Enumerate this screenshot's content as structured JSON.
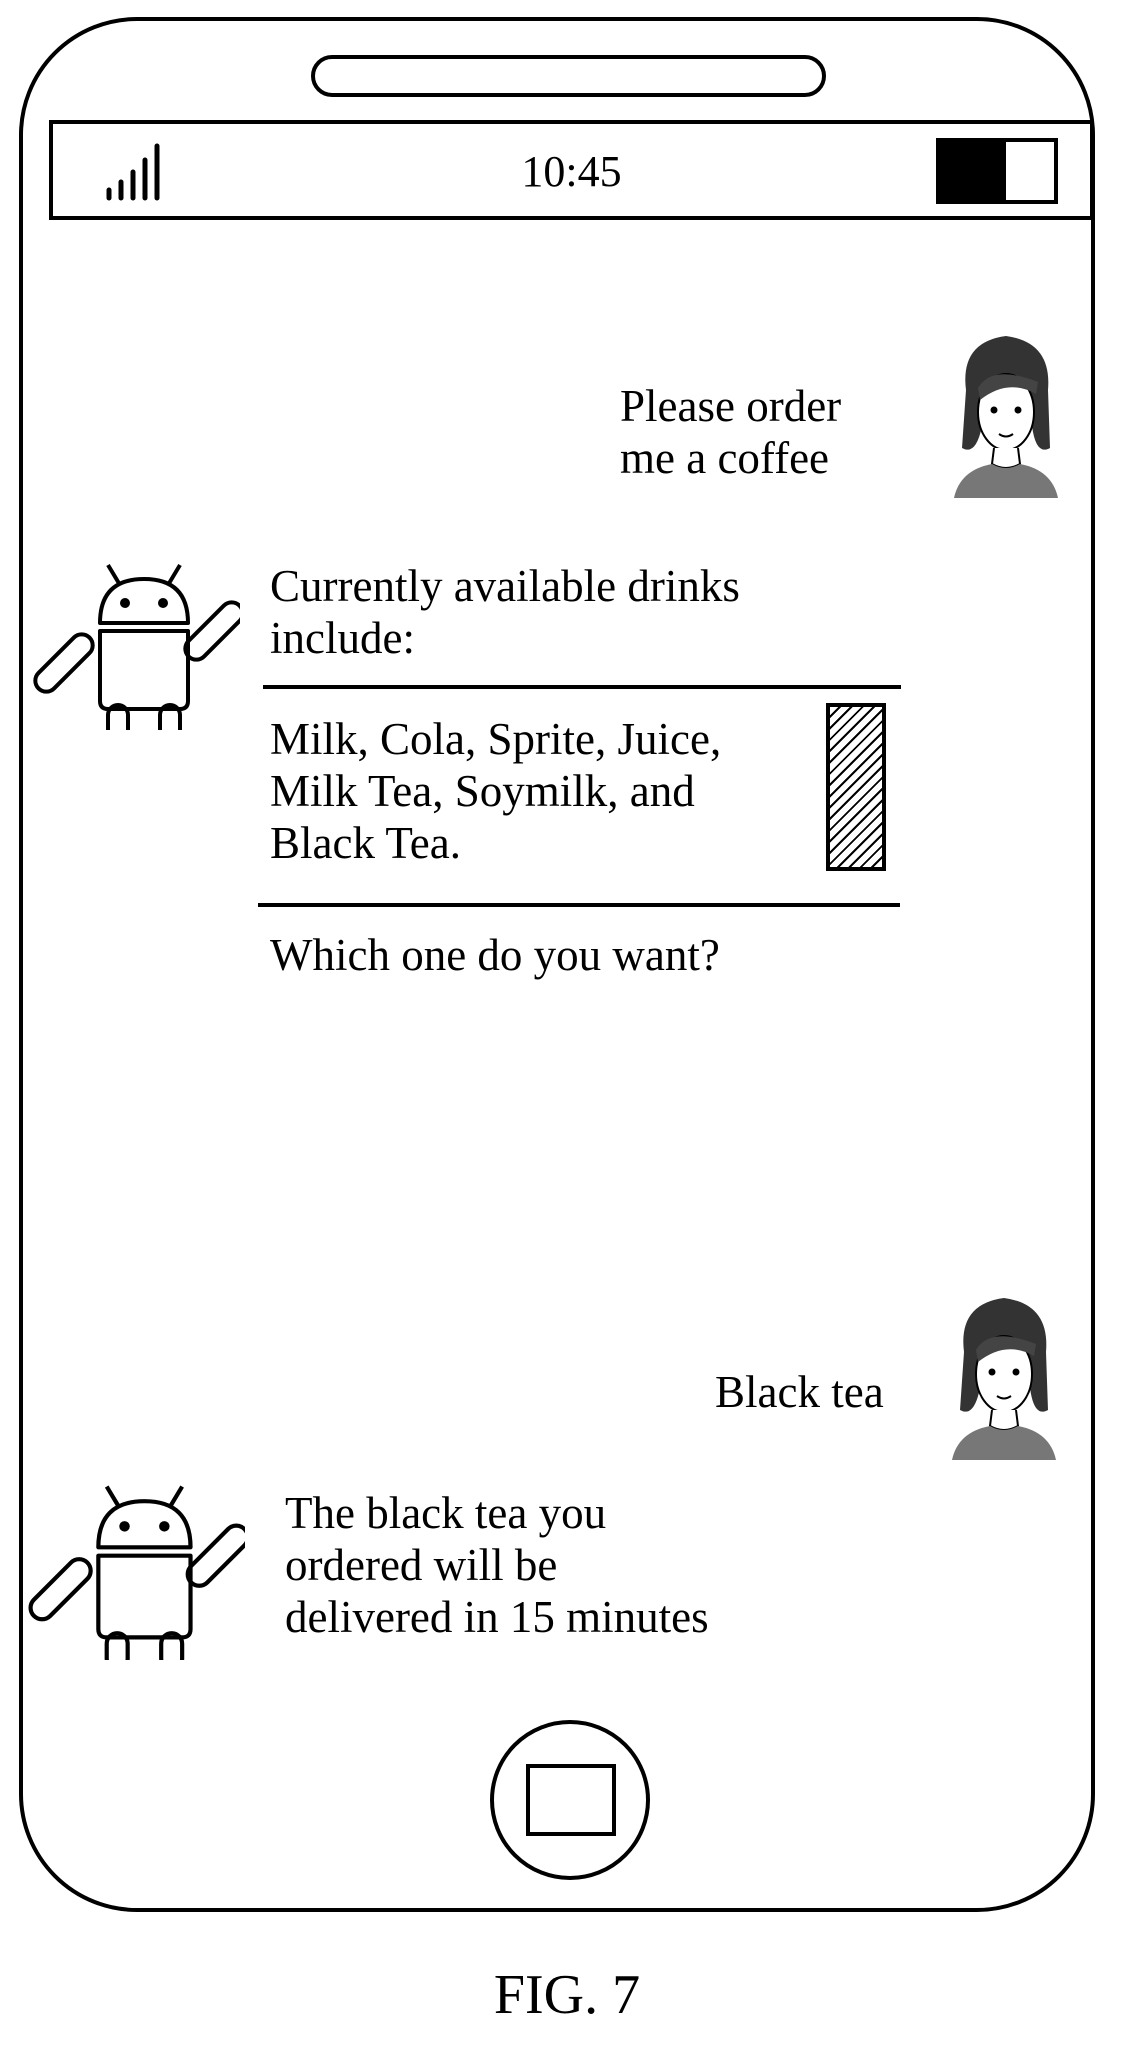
{
  "status_bar": {
    "time": "10:45",
    "icons": [
      "signal-strength-icon",
      "battery-icon"
    ]
  },
  "conversation": {
    "user_message_1": "Please order\nme a coffee",
    "bot_message_1_intro": "Currently available drinks\ninclude:",
    "bot_message_1_list": "Milk, Cola, Sprite, Juice,\nMilk Tea, Soymilk, and\nBlack Tea.",
    "bot_message_1_question": "Which one do you want?",
    "user_message_2": "Black tea",
    "bot_message_2": "The black tea you\nordered will be\ndelivered in 15 minutes"
  },
  "icons": {
    "user_avatar": "user-avatar-icon",
    "assistant_avatar": "android-robot-icon",
    "home_button": "home-button-icon"
  },
  "figure_label": "FIG. 7"
}
